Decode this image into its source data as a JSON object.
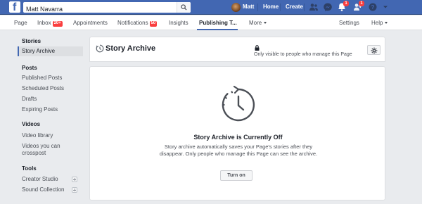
{
  "topbar": {
    "search_value": "Matt Navarra",
    "user_name": "Matt",
    "links": [
      "Home",
      "Create"
    ],
    "notification_count": "1",
    "friend_requests_count": "1"
  },
  "pagenav": {
    "tabs": [
      {
        "label": "Page"
      },
      {
        "label": "Inbox",
        "badge": "20+"
      },
      {
        "label": "Appointments"
      },
      {
        "label": "Notifications",
        "badge": "50"
      },
      {
        "label": "Insights"
      },
      {
        "label": "Publishing T..."
      },
      {
        "label": "More"
      }
    ],
    "settings": "Settings",
    "help": "Help"
  },
  "sidebar": {
    "sections": [
      {
        "title": "Stories",
        "items": [
          "Story Archive"
        ]
      },
      {
        "title": "Posts",
        "items": [
          "Published Posts",
          "Scheduled Posts",
          "Drafts",
          "Expiring Posts"
        ]
      },
      {
        "title": "Videos",
        "items": [
          "Video library",
          "Videos you can crosspost"
        ]
      },
      {
        "title": "Tools",
        "items": [
          "Creator Studio",
          "Sound Collection"
        ]
      }
    ]
  },
  "main": {
    "title": "Story Archive",
    "visibility": "Only visible to people who manage this Page",
    "empty_title": "Story Archive is Currently Off",
    "empty_desc": "Story archive automatically saves your Page's stories after they disappear. Only people who manage this Page can see the archive.",
    "button_label": "Turn on"
  },
  "colors": {
    "brand": "#4267b2",
    "badge": "#fa3e3e",
    "background": "#e9ebee"
  }
}
